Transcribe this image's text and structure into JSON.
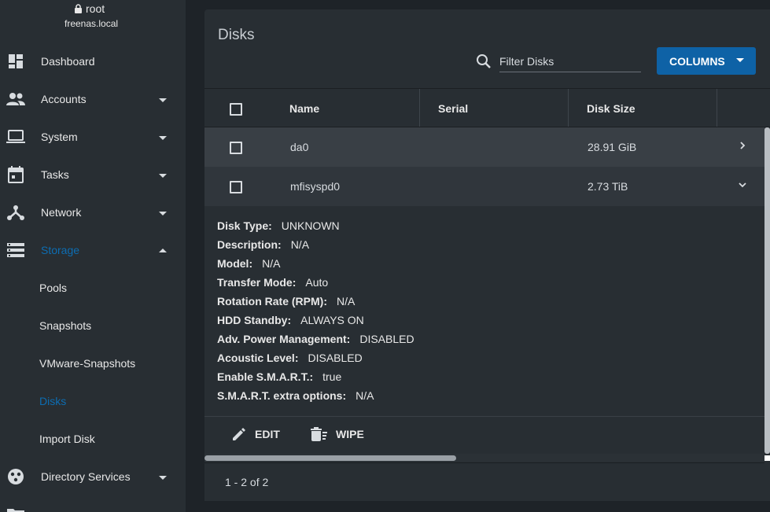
{
  "user": {
    "name": "root",
    "host": "freenas.local"
  },
  "sidebar": {
    "items": [
      {
        "label": "Dashboard",
        "icon": "dashboard-icon",
        "arrow": ""
      },
      {
        "label": "Accounts",
        "icon": "people-icon",
        "arrow": "down"
      },
      {
        "label": "System",
        "icon": "laptop-icon",
        "arrow": "down"
      },
      {
        "label": "Tasks",
        "icon": "calendar-icon",
        "arrow": "down"
      },
      {
        "label": "Network",
        "icon": "network-icon",
        "arrow": "down"
      },
      {
        "label": "Storage",
        "icon": "storage-icon",
        "arrow": "up",
        "active": true
      },
      {
        "label": "Directory Services",
        "icon": "directory-services-icon",
        "arrow": "down"
      }
    ],
    "storage_sub": [
      {
        "label": "Pools"
      },
      {
        "label": "Snapshots"
      },
      {
        "label": "VMware-Snapshots"
      },
      {
        "label": "Disks",
        "active": true
      },
      {
        "label": "Import Disk"
      }
    ],
    "active_color": "#0d6db2"
  },
  "main": {
    "title": "Disks",
    "filter_placeholder": "Filter Disks",
    "columns_label": "COLUMNS",
    "table": {
      "headers": [
        "Name",
        "Serial",
        "Disk Size"
      ],
      "rows": [
        {
          "name": "da0",
          "serial": "",
          "size": "28.91 GiB",
          "expanded": false
        },
        {
          "name": "mfisyspd0",
          "serial": "",
          "size": "2.73 TiB",
          "expanded": true
        }
      ]
    },
    "details": [
      {
        "key": "Disk Type:",
        "value": "UNKNOWN"
      },
      {
        "key": "Description:",
        "value": "N/A"
      },
      {
        "key": "Model:",
        "value": "N/A"
      },
      {
        "key": "Transfer Mode:",
        "value": "Auto"
      },
      {
        "key": "Rotation Rate (RPM):",
        "value": "N/A"
      },
      {
        "key": "HDD Standby:",
        "value": "ALWAYS ON"
      },
      {
        "key": "Adv. Power Management:",
        "value": "DISABLED"
      },
      {
        "key": "Acoustic Level:",
        "value": "DISABLED"
      },
      {
        "key": "Enable S.M.A.R.T.:",
        "value": "true"
      },
      {
        "key": "S.M.A.R.T. extra options:",
        "value": "N/A"
      }
    ],
    "actions": {
      "edit": "EDIT",
      "wipe": "WIPE"
    },
    "pager": "1 - 2 of 2",
    "accent": "#0e62a6"
  }
}
